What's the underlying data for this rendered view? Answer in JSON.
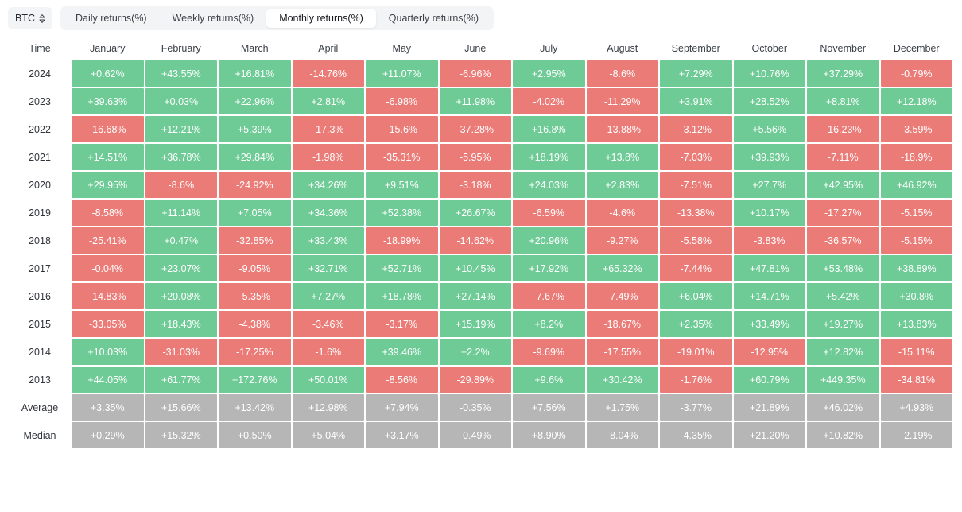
{
  "toolbar": {
    "symbol": "BTC",
    "symbol_icon": "chevron-up-down-icon",
    "tabs": [
      {
        "label": "Daily returns(%)",
        "active": false
      },
      {
        "label": "Weekly returns(%)",
        "active": false
      },
      {
        "label": "Monthly returns(%)",
        "active": true
      },
      {
        "label": "Quarterly returns(%)",
        "active": false
      }
    ]
  },
  "colors": {
    "positive": "#6ecb96",
    "negative": "#eb7b77",
    "neutral": "#b6b6b6",
    "tab_bar": "#f3f4f6",
    "tab_active": "#ffffff"
  },
  "chart_data": {
    "type": "heatmap",
    "title": "Monthly returns(%)",
    "xlabel": "",
    "ylabel": "Time",
    "grid": true,
    "legend": "none",
    "columns": [
      "Time",
      "January",
      "February",
      "March",
      "April",
      "May",
      "June",
      "July",
      "August",
      "September",
      "October",
      "November",
      "December"
    ],
    "categories": [
      "January",
      "February",
      "March",
      "April",
      "May",
      "June",
      "July",
      "August",
      "September",
      "October",
      "November",
      "December"
    ],
    "rows": [
      {
        "label": "2024",
        "kind": "year",
        "values": [
          "+0.62%",
          "+43.55%",
          "+16.81%",
          "-14.76%",
          "+11.07%",
          "-6.96%",
          "+2.95%",
          "-8.6%",
          "+7.29%",
          "+10.76%",
          "+37.29%",
          "-0.79%"
        ]
      },
      {
        "label": "2023",
        "kind": "year",
        "values": [
          "+39.63%",
          "+0.03%",
          "+22.96%",
          "+2.81%",
          "-6.98%",
          "+11.98%",
          "-4.02%",
          "-11.29%",
          "+3.91%",
          "+28.52%",
          "+8.81%",
          "+12.18%"
        ]
      },
      {
        "label": "2022",
        "kind": "year",
        "values": [
          "-16.68%",
          "+12.21%",
          "+5.39%",
          "-17.3%",
          "-15.6%",
          "-37.28%",
          "+16.8%",
          "-13.88%",
          "-3.12%",
          "+5.56%",
          "-16.23%",
          "-3.59%"
        ]
      },
      {
        "label": "2021",
        "kind": "year",
        "values": [
          "+14.51%",
          "+36.78%",
          "+29.84%",
          "-1.98%",
          "-35.31%",
          "-5.95%",
          "+18.19%",
          "+13.8%",
          "-7.03%",
          "+39.93%",
          "-7.11%",
          "-18.9%"
        ]
      },
      {
        "label": "2020",
        "kind": "year",
        "values": [
          "+29.95%",
          "-8.6%",
          "-24.92%",
          "+34.26%",
          "+9.51%",
          "-3.18%",
          "+24.03%",
          "+2.83%",
          "-7.51%",
          "+27.7%",
          "+42.95%",
          "+46.92%"
        ]
      },
      {
        "label": "2019",
        "kind": "year",
        "values": [
          "-8.58%",
          "+11.14%",
          "+7.05%",
          "+34.36%",
          "+52.38%",
          "+26.67%",
          "-6.59%",
          "-4.6%",
          "-13.38%",
          "+10.17%",
          "-17.27%",
          "-5.15%"
        ]
      },
      {
        "label": "2018",
        "kind": "year",
        "values": [
          "-25.41%",
          "+0.47%",
          "-32.85%",
          "+33.43%",
          "-18.99%",
          "-14.62%",
          "+20.96%",
          "-9.27%",
          "-5.58%",
          "-3.83%",
          "-36.57%",
          "-5.15%"
        ]
      },
      {
        "label": "2017",
        "kind": "year",
        "values": [
          "-0.04%",
          "+23.07%",
          "-9.05%",
          "+32.71%",
          "+52.71%",
          "+10.45%",
          "+17.92%",
          "+65.32%",
          "-7.44%",
          "+47.81%",
          "+53.48%",
          "+38.89%"
        ]
      },
      {
        "label": "2016",
        "kind": "year",
        "values": [
          "-14.83%",
          "+20.08%",
          "-5.35%",
          "+7.27%",
          "+18.78%",
          "+27.14%",
          "-7.67%",
          "-7.49%",
          "+6.04%",
          "+14.71%",
          "+5.42%",
          "+30.8%"
        ]
      },
      {
        "label": "2015",
        "kind": "year",
        "values": [
          "-33.05%",
          "+18.43%",
          "-4.38%",
          "-3.46%",
          "-3.17%",
          "+15.19%",
          "+8.2%",
          "-18.67%",
          "+2.35%",
          "+33.49%",
          "+19.27%",
          "+13.83%"
        ]
      },
      {
        "label": "2014",
        "kind": "year",
        "values": [
          "+10.03%",
          "-31.03%",
          "-17.25%",
          "-1.6%",
          "+39.46%",
          "+2.2%",
          "-9.69%",
          "-17.55%",
          "-19.01%",
          "-12.95%",
          "+12.82%",
          "-15.11%"
        ]
      },
      {
        "label": "2013",
        "kind": "year",
        "values": [
          "+44.05%",
          "+61.77%",
          "+172.76%",
          "+50.01%",
          "-8.56%",
          "-29.89%",
          "+9.6%",
          "+30.42%",
          "-1.76%",
          "+60.79%",
          "+449.35%",
          "-34.81%"
        ]
      },
      {
        "label": "Average",
        "kind": "summary",
        "values": [
          "+3.35%",
          "+15.66%",
          "+13.42%",
          "+12.98%",
          "+7.94%",
          "-0.35%",
          "+7.56%",
          "+1.75%",
          "-3.77%",
          "+21.89%",
          "+46.02%",
          "+4.93%"
        ]
      },
      {
        "label": "Median",
        "kind": "summary",
        "values": [
          "+0.29%",
          "+15.32%",
          "+0.50%",
          "+5.04%",
          "+3.17%",
          "-0.49%",
          "+8.90%",
          "-8.04%",
          "-4.35%",
          "+21.20%",
          "+10.82%",
          "-2.19%"
        ]
      }
    ]
  }
}
